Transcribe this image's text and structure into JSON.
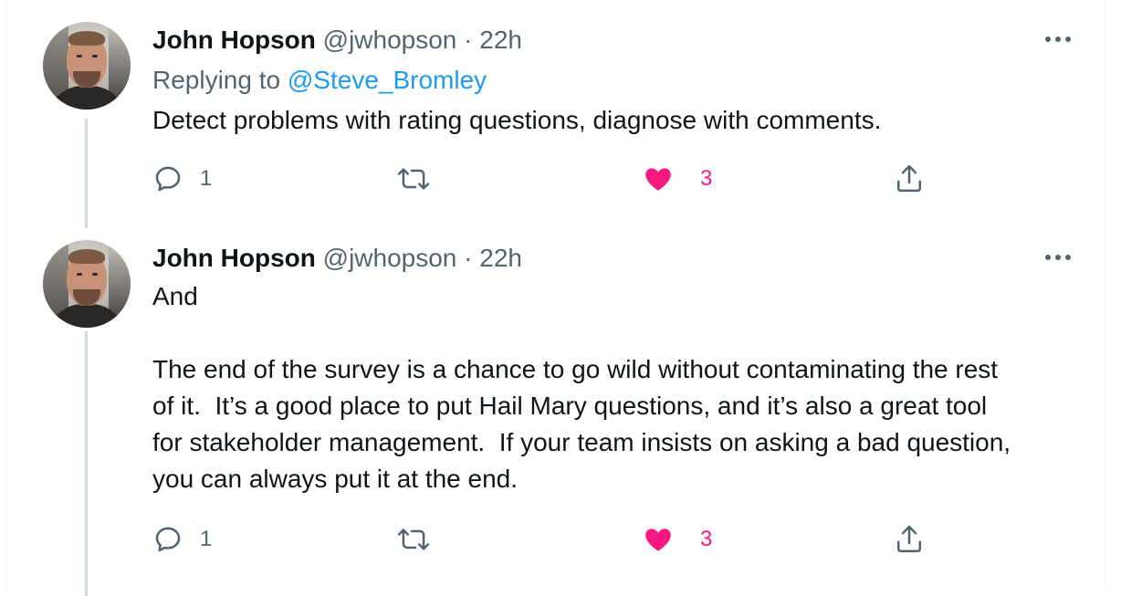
{
  "tweets": [
    {
      "author_name": "John Hopson",
      "handle": "@jwhopson",
      "separator": "·",
      "time": "22h",
      "replying_prefix": "Replying to",
      "replying_handle": "@Steve_Bromley",
      "text": "Detect problems with rating questions, diagnose with comments.",
      "reply_count": "1",
      "like_count": "3"
    },
    {
      "author_name": "John Hopson",
      "handle": "@jwhopson",
      "separator": "·",
      "time": "22h",
      "text": "And\n\nThe end of the survey is a chance to go wild without contaminating the rest\nof it.  It’s a good place to put Hail Mary questions, and it’s also a great tool\nfor stakeholder management.  If your team insists on asking a bad question,\nyou can always put it at the end.",
      "reply_count": "1",
      "like_count": "3"
    }
  ],
  "icons": {
    "reply": "reply-icon",
    "retweet": "retweet-icon",
    "like": "heart-icon",
    "share": "share-icon",
    "more": "more-icon"
  },
  "colors": {
    "text": "#0f1419",
    "secondary": "#536471",
    "link": "#1d9bf0",
    "like": "#f91880",
    "thread_line": "#cfd9de"
  }
}
